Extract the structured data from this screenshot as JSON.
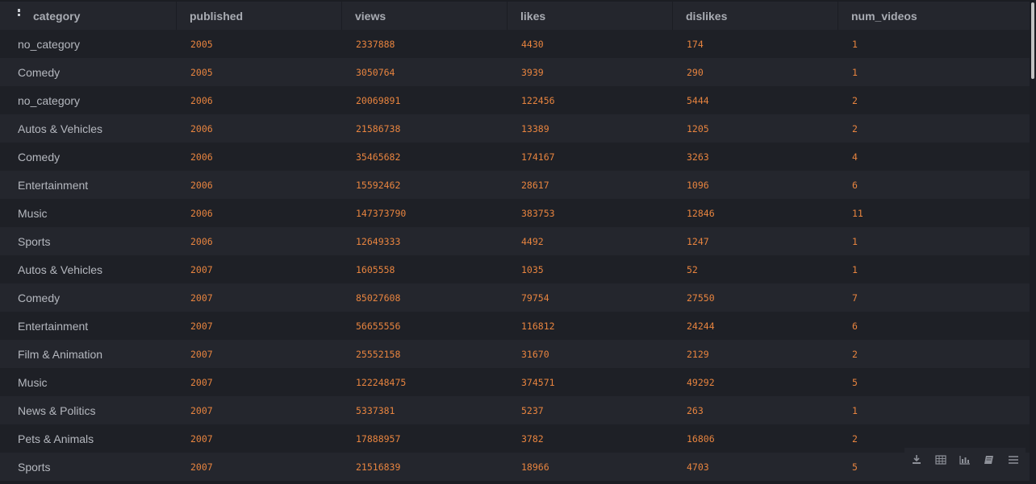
{
  "table": {
    "columns": [
      "category",
      "published",
      "views",
      "likes",
      "dislikes",
      "num_videos"
    ],
    "rows": [
      [
        "no_category",
        "2005",
        "2337888",
        "4430",
        "174",
        "1"
      ],
      [
        "Comedy",
        "2005",
        "3050764",
        "3939",
        "290",
        "1"
      ],
      [
        "no_category",
        "2006",
        "20069891",
        "122456",
        "5444",
        "2"
      ],
      [
        "Autos & Vehicles",
        "2006",
        "21586738",
        "13389",
        "1205",
        "2"
      ],
      [
        "Comedy",
        "2006",
        "35465682",
        "174167",
        "3263",
        "4"
      ],
      [
        "Entertainment",
        "2006",
        "15592462",
        "28617",
        "1096",
        "6"
      ],
      [
        "Music",
        "2006",
        "147373790",
        "383753",
        "12846",
        "11"
      ],
      [
        "Sports",
        "2006",
        "12649333",
        "4492",
        "1247",
        "1"
      ],
      [
        "Autos & Vehicles",
        "2007",
        "1605558",
        "1035",
        "52",
        "1"
      ],
      [
        "Comedy",
        "2007",
        "85027608",
        "79754",
        "27550",
        "7"
      ],
      [
        "Entertainment",
        "2007",
        "56655556",
        "116812",
        "24244",
        "6"
      ],
      [
        "Film & Animation",
        "2007",
        "25552158",
        "31670",
        "2129",
        "2"
      ],
      [
        "Music",
        "2007",
        "122248475",
        "374571",
        "49292",
        "5"
      ],
      [
        "News & Politics",
        "2007",
        "5337381",
        "5237",
        "263",
        "1"
      ],
      [
        "Pets & Animals",
        "2007",
        "17888957",
        "3782",
        "16806",
        "2"
      ],
      [
        "Sports",
        "2007",
        "21516839",
        "18966",
        "4703",
        "5"
      ]
    ]
  },
  "toolbar": {
    "tools": [
      "download-icon",
      "table-icon",
      "bar-chart-icon",
      "notebook-icon",
      "menu-icon"
    ]
  },
  "colors": {
    "background": "#1b1d23",
    "row_even": "#24262d",
    "row_odd": "#1e2026",
    "header_text": "#a9acb3",
    "text": "#b5b8bf",
    "number": "#e8843f"
  }
}
